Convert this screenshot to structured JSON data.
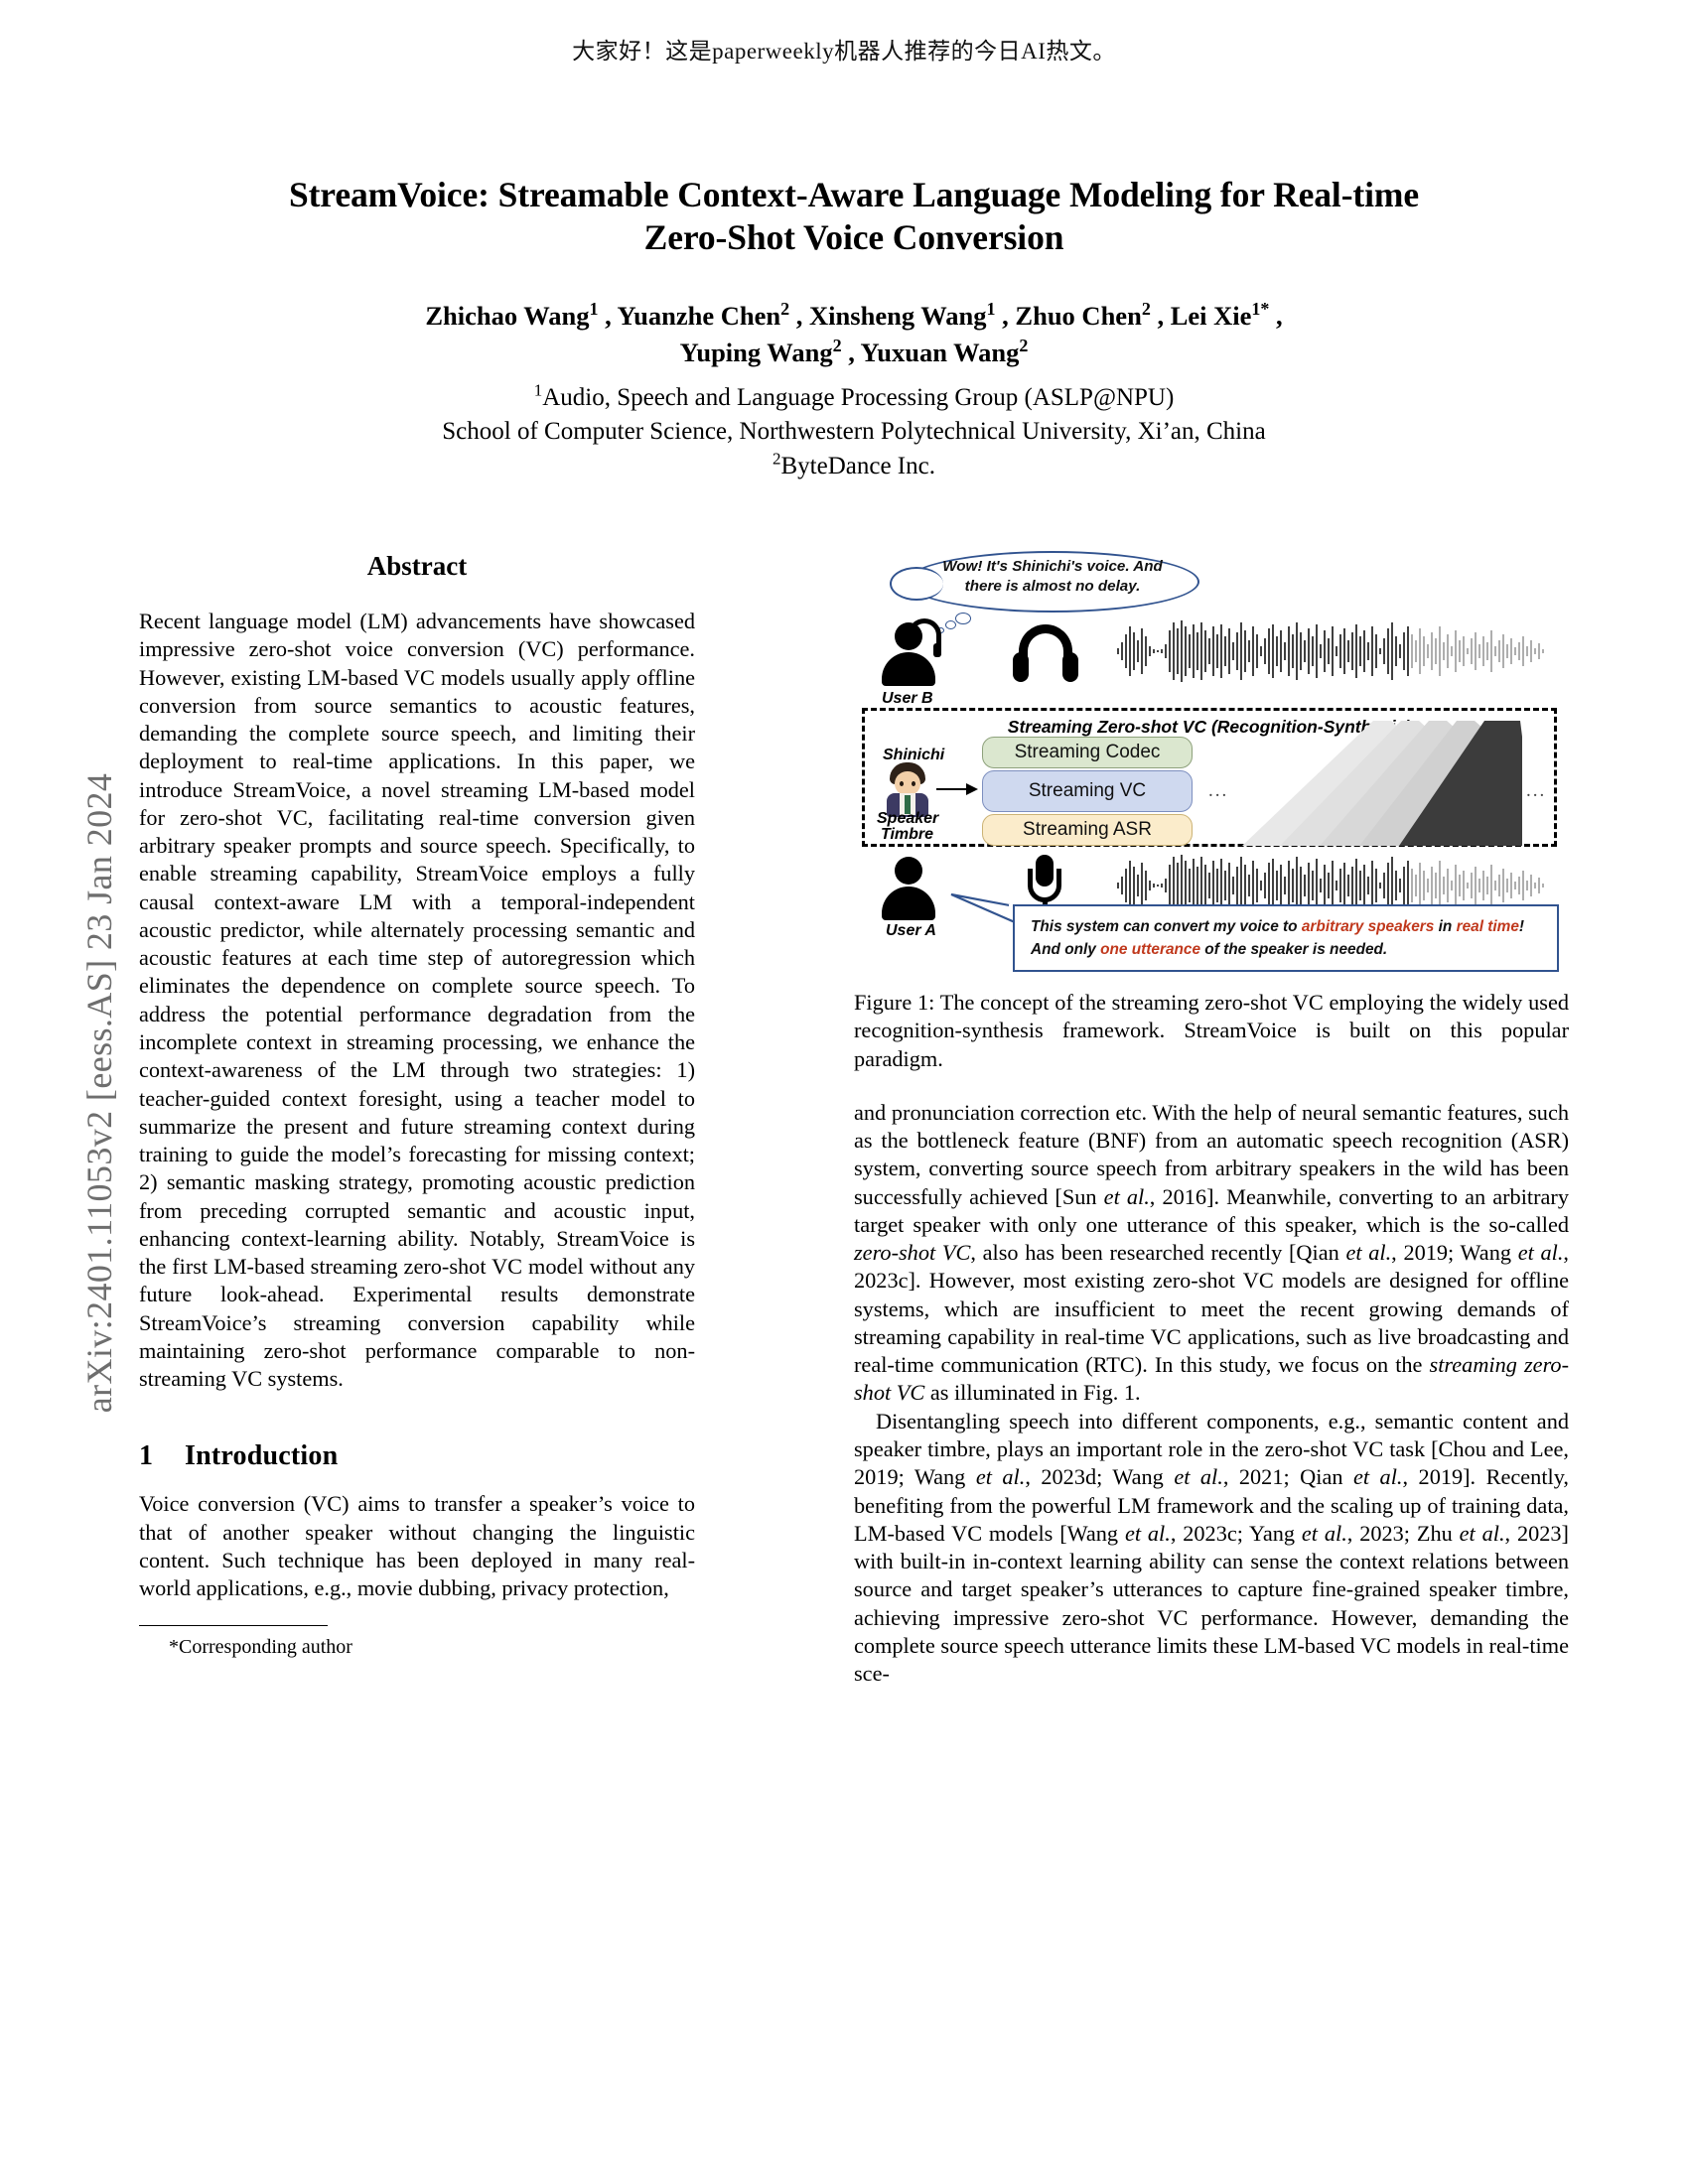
{
  "banner": {
    "text": "大家好！这是paperweekly机器人推荐的今日AI热文。"
  },
  "arxiv_stamp": {
    "text": "arXiv:2401.11053v2  [eess.AS]  23 Jan 2024"
  },
  "paper": {
    "title_line1": "StreamVoice: Streamable Context-Aware Language Modeling for Real-time",
    "title_line2": "Zero-Shot Voice Conversion",
    "authors": [
      {
        "name": "Zhichao Wang",
        "sup": "1"
      },
      {
        "name": "Yuanzhe Chen",
        "sup": "2"
      },
      {
        "name": "Xinsheng Wang",
        "sup": "1"
      },
      {
        "name": "Zhuo Chen",
        "sup": "2"
      },
      {
        "name": "Lei Xie",
        "sup": "1*"
      },
      {
        "name": "Yuping Wang",
        "sup": "2"
      },
      {
        "name": "Yuxuan Wang",
        "sup": "2"
      }
    ],
    "affiliations": [
      {
        "sup": "1",
        "text": "Audio, Speech and Language Processing Group (ASLP@NPU)"
      },
      {
        "sup": "",
        "text": "School of Computer Science, Northwestern Polytechnical University, Xi’an, China"
      },
      {
        "sup": "2",
        "text": "ByteDance Inc."
      }
    ],
    "footnote": "*Corresponding author"
  },
  "abstract": {
    "heading": "Abstract",
    "text": "Recent language model (LM) advancements have showcased impressive zero-shot voice conversion (VC) performance. However, existing LM-based VC models usually apply offline conversion from source semantics to acoustic features, demanding the complete source speech, and limiting their deployment to real-time applications. In this paper, we introduce StreamVoice, a novel streaming LM-based model for zero-shot VC, facilitating real-time conversion given arbitrary speaker prompts and source speech. Specifically, to enable streaming capability, StreamVoice employs a fully causal context-aware LM with a temporal-independent acoustic predictor, while alternately processing semantic and acoustic features at each time step of autoregression which eliminates the dependence on complete source speech. To address the potential performance degradation from the incomplete context in streaming processing, we enhance the context-awareness of the LM through two strategies: 1) teacher-guided context foresight, using a teacher model to summarize the present and future streaming context during training to guide the model’s forecasting for missing context; 2) semantic masking strategy, promoting acoustic prediction from preceding corrupted semantic and acoustic input, enhancing context-learning ability. Notably, StreamVoice is the first LM-based streaming zero-shot VC model without any future look-ahead. Experimental results demonstrate StreamVoice’s streaming conversion capability while maintaining zero-shot performance comparable to non-streaming VC systems."
  },
  "introduction": {
    "number": "1",
    "heading": "Introduction",
    "paragraph1": "Voice conversion (VC) aims to transfer a speaker’s voice to that of another speaker without changing the linguistic content. Such technique has been deployed in many real-world applications, e.g., movie dubbing, privacy protection,"
  },
  "figure": {
    "caption": "Figure 1: The concept of the streaming zero-shot VC employing the widely used recognition-synthesis framework. StreamVoice is built on this popular paradigm.",
    "thought_bubble": "Wow! It's Shinichi's voice. And there is almost no delay.",
    "user_b_label": "User B",
    "user_a_label": "User A",
    "box_title": "Streaming Zero-shot VC (Recognition-Synthesis)",
    "modules": [
      {
        "label": "Streaming Codec",
        "color": "#dbe7cf"
      },
      {
        "label": "Streaming VC",
        "color": "#cfd9ef"
      },
      {
        "label": "Streaming ASR",
        "color": "#fbeccb"
      }
    ],
    "speaker_name": "Shinichi",
    "speaker_timbre_line1": "Speaker",
    "speaker_timbre_line2": "Timbre",
    "ellipsis": "...",
    "speech_segments": [
      {
        "text": "This system can convert my voice  to ",
        "highlight": false
      },
      {
        "text": "arbitrary speakers",
        "highlight": true
      },
      {
        "text": " in ",
        "highlight": false
      },
      {
        "text": "real time",
        "highlight": true
      },
      {
        "text": "! And only ",
        "highlight": false
      },
      {
        "text": "one utterance",
        "highlight": true
      },
      {
        "text": " of the speaker is needed.",
        "highlight": false
      }
    ],
    "accent_color": "#c0381c",
    "outline_color": "#31538f"
  },
  "right_column": {
    "paragraph1": "and pronunciation correction etc. With the help of neural semantic features, such as the bottleneck feature (BNF) from an automatic speech recognition (ASR) system, converting source speech from arbitrary speakers in the wild has been successfully achieved [Sun <i>et al.</i>, 2016]. Meanwhile, converting to an arbitrary target speaker with only one utterance of this speaker, which is the so-called <i>zero-shot VC</i>, also has been researched recently [Qian <i>et al.</i>, 2019; Wang <i>et al.</i>, 2023c]. However, most existing zero-shot VC models are designed for offline systems, which are insufficient to meet the recent growing demands of streaming capability in real-time VC applications, such as live broadcasting and real-time communication (RTC). In this study, we focus on the <i>streaming zero-shot VC</i> as illuminated in Fig. 1.",
    "paragraph2": "Disentangling speech into different components, e.g., semantic content and speaker timbre, plays an important role in the zero-shot VC task [Chou and Lee, 2019; Wang <i>et al.</i>, 2023d; Wang <i>et al.</i>, 2021; Qian <i>et al.</i>, 2019]. Recently, benefiting from the powerful LM framework and the scaling up of training data, LM-based VC models [Wang <i>et al.</i>, 2023c; Yang <i>et al.</i>, 2023; Zhu <i>et al.</i>, 2023] with built-in in-context learning ability can sense the context relations between source and target speaker’s utterances to capture fine-grained speaker timbre, achieving impressive zero-shot VC performance. However, demanding the complete source speech utterance limits these LM-based VC models in real-time sce-"
  }
}
